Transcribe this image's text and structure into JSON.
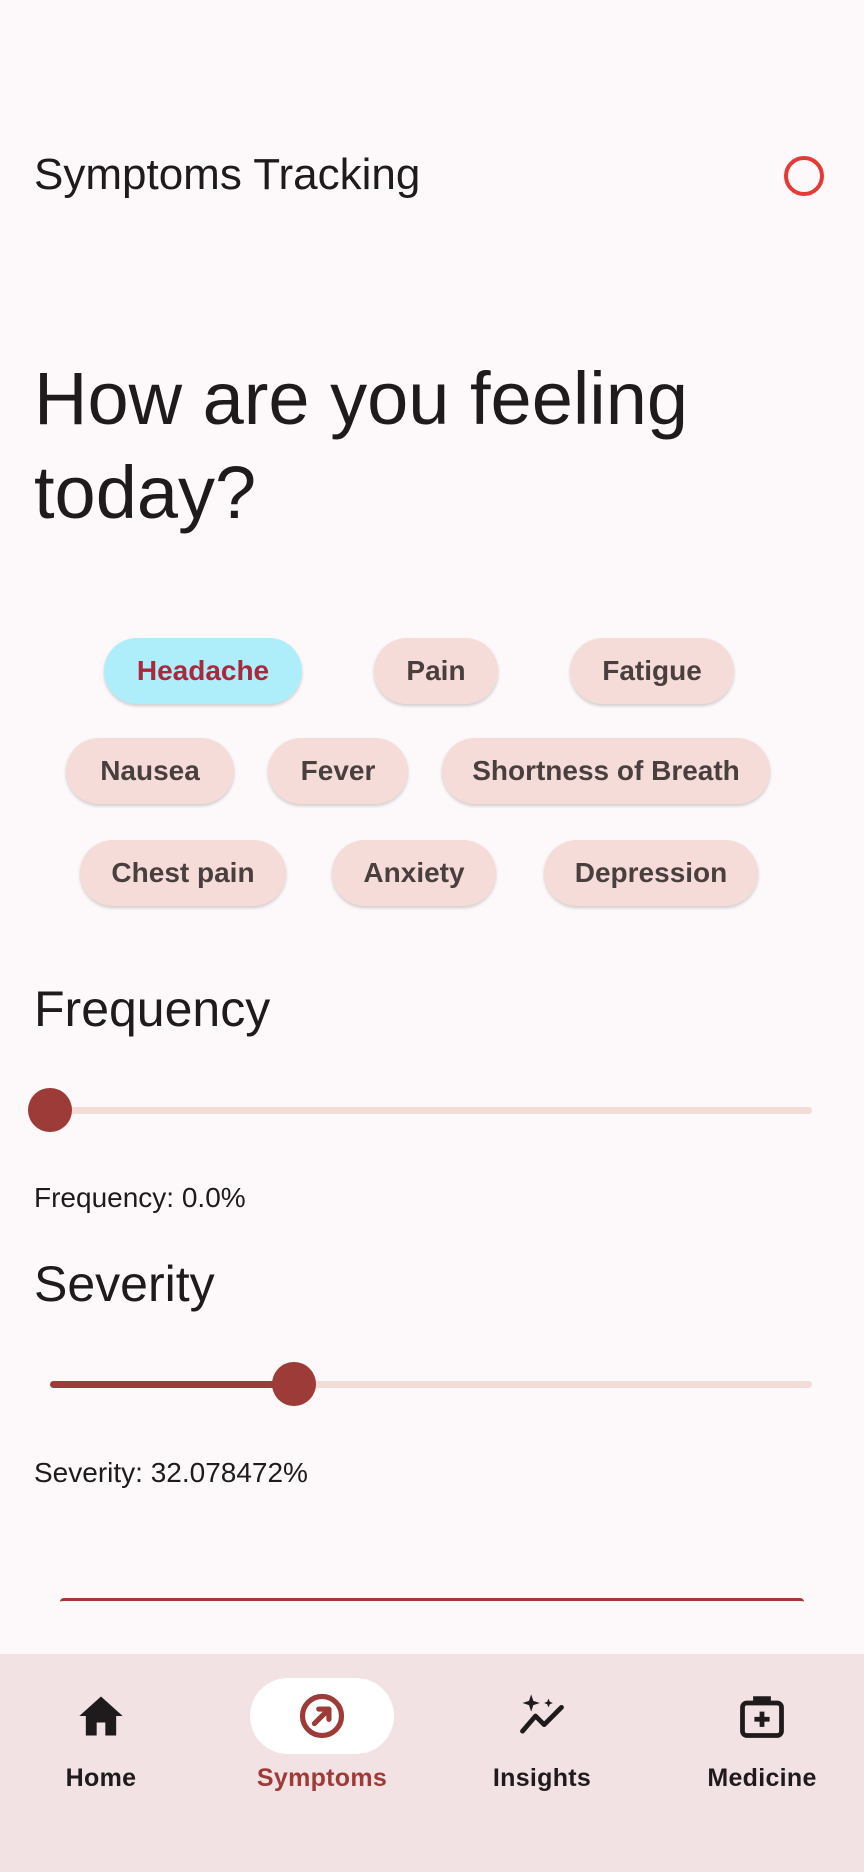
{
  "app_bar": {
    "title": "Symptoms Tracking"
  },
  "headline": "How are you feeling today?",
  "symptoms": [
    {
      "label": "Headache",
      "selected": true
    },
    {
      "label": "Pain",
      "selected": false
    },
    {
      "label": "Fatigue",
      "selected": false
    },
    {
      "label": "Nausea",
      "selected": false
    },
    {
      "label": "Fever",
      "selected": false
    },
    {
      "label": "Shortness of Breath",
      "selected": false
    },
    {
      "label": "Chest pain",
      "selected": false
    },
    {
      "label": "Anxiety",
      "selected": false
    },
    {
      "label": "Depression",
      "selected": false
    }
  ],
  "frequency": {
    "title": "Frequency",
    "value_text": "Frequency: 0.0%",
    "level": 0.0
  },
  "severity": {
    "title": "Severity",
    "value_text": "Severity: 32.078472%",
    "level": 0.32078472
  },
  "nav": {
    "items": [
      {
        "label": "Home",
        "icon": "home-icon",
        "active": false
      },
      {
        "label": "Symptoms",
        "icon": "symptoms-icon",
        "active": true
      },
      {
        "label": "Insights",
        "icon": "insights-icon",
        "active": false
      },
      {
        "label": "Medicine",
        "icon": "medicine-icon",
        "active": false
      }
    ]
  },
  "colors": {
    "accent": "#9c3b38",
    "chip": "#f6dcd8",
    "chip_selected": "#aeeefb",
    "chip_selected_text": "#a8283c",
    "status_ring": "#e53935",
    "nav_background": "#f2e2e3"
  }
}
